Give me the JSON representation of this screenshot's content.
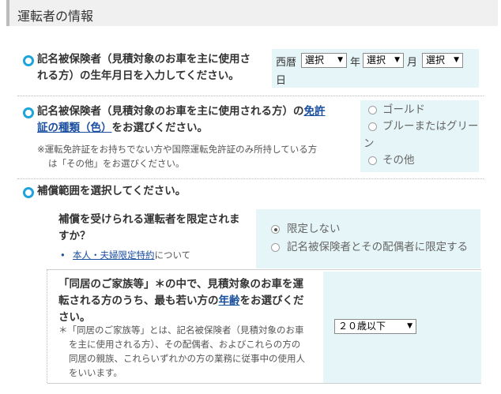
{
  "section": {
    "title": "運転者の情報"
  },
  "q1": {
    "label_line1": "記名被保険者（見積対象のお車を主に使用さ",
    "label_line2": "れる方）の生年月日を入力してください。",
    "era_label": "西暦",
    "year_select": "選択",
    "year_label": "年",
    "month_select": "選択",
    "month_label": "月",
    "day_select": "選択",
    "day_label": "日"
  },
  "q2": {
    "label_line1_pre": "記名被保険者（見積対象のお車を主に使用される方）の",
    "label_link1": "免許",
    "label_link2": "証の種類（色）",
    "label_line2_post": "をお選びください。",
    "note_line1": "※運転免許証をお持ちでない方や国際運転免許証のみ所持している方",
    "note_line2": "は「その他」をお選びください。",
    "options": [
      "ゴールド",
      "ブルーまたはグリー",
      "ン",
      "その他"
    ]
  },
  "q3": {
    "label": "補償範囲を選択してください。",
    "sub1": {
      "label_line1": "補償を受けられる運転者を限定されま",
      "label_line2": "すか？",
      "bullet": "•",
      "link": "本人・夫婦限定特約",
      "link_suffix": "について",
      "options": [
        "限定しない",
        "記名被保険者とその配偶者に限定する"
      ]
    },
    "sub2": {
      "label_line1": "「同居のご家族等」＊の中で、見積対象のお車を運",
      "label_line2": "転される方のうち、最も若い方の",
      "label_link": "年齢",
      "label_line2_post": "をお選びくだ",
      "label_line3": "さい。",
      "note_line1": "＊「同居のご家族等」とは、記名被保険者（見積対象のお車",
      "note_line2": "を主に使用される方）、その配偶者、およびこれらの方の",
      "note_line3": "同居の親族、これらいずれかの方の業務に従事中の使用人",
      "note_line4": "をいいます。",
      "age_select": "２０歳以下"
    }
  }
}
